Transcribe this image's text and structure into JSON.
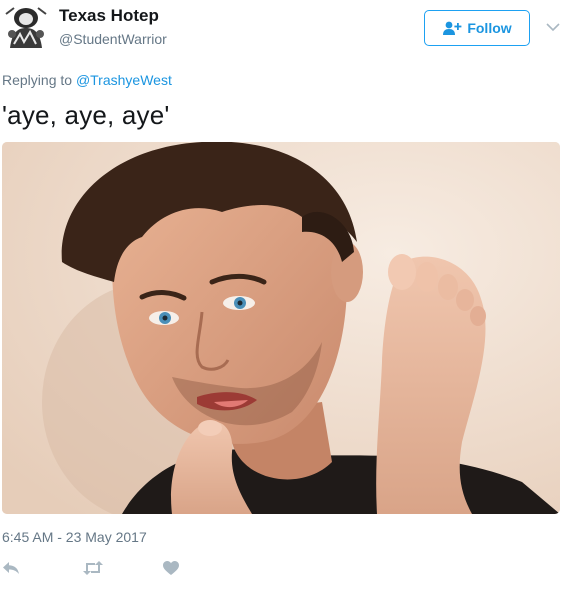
{
  "tweet": {
    "display_name": "Texas Hotep",
    "handle": "@StudentWarrior",
    "follow_label": "Follow",
    "replying_prefix": "Replying to",
    "replying_to": "@TrashyeWest",
    "text": "'aye, aye, aye'",
    "timestamp": "6:45 AM - 23 May 2017"
  },
  "icons": {
    "follow": "user-plus-icon",
    "caret": "chevron-down-icon",
    "reply": "reply-icon",
    "retweet": "retweet-icon",
    "like": "heart-icon"
  },
  "colors": {
    "accent": "#1da1f2",
    "link": "#1b95e0",
    "muted": "#657786",
    "text": "#14171a",
    "icon_gray": "#aab8c2"
  }
}
